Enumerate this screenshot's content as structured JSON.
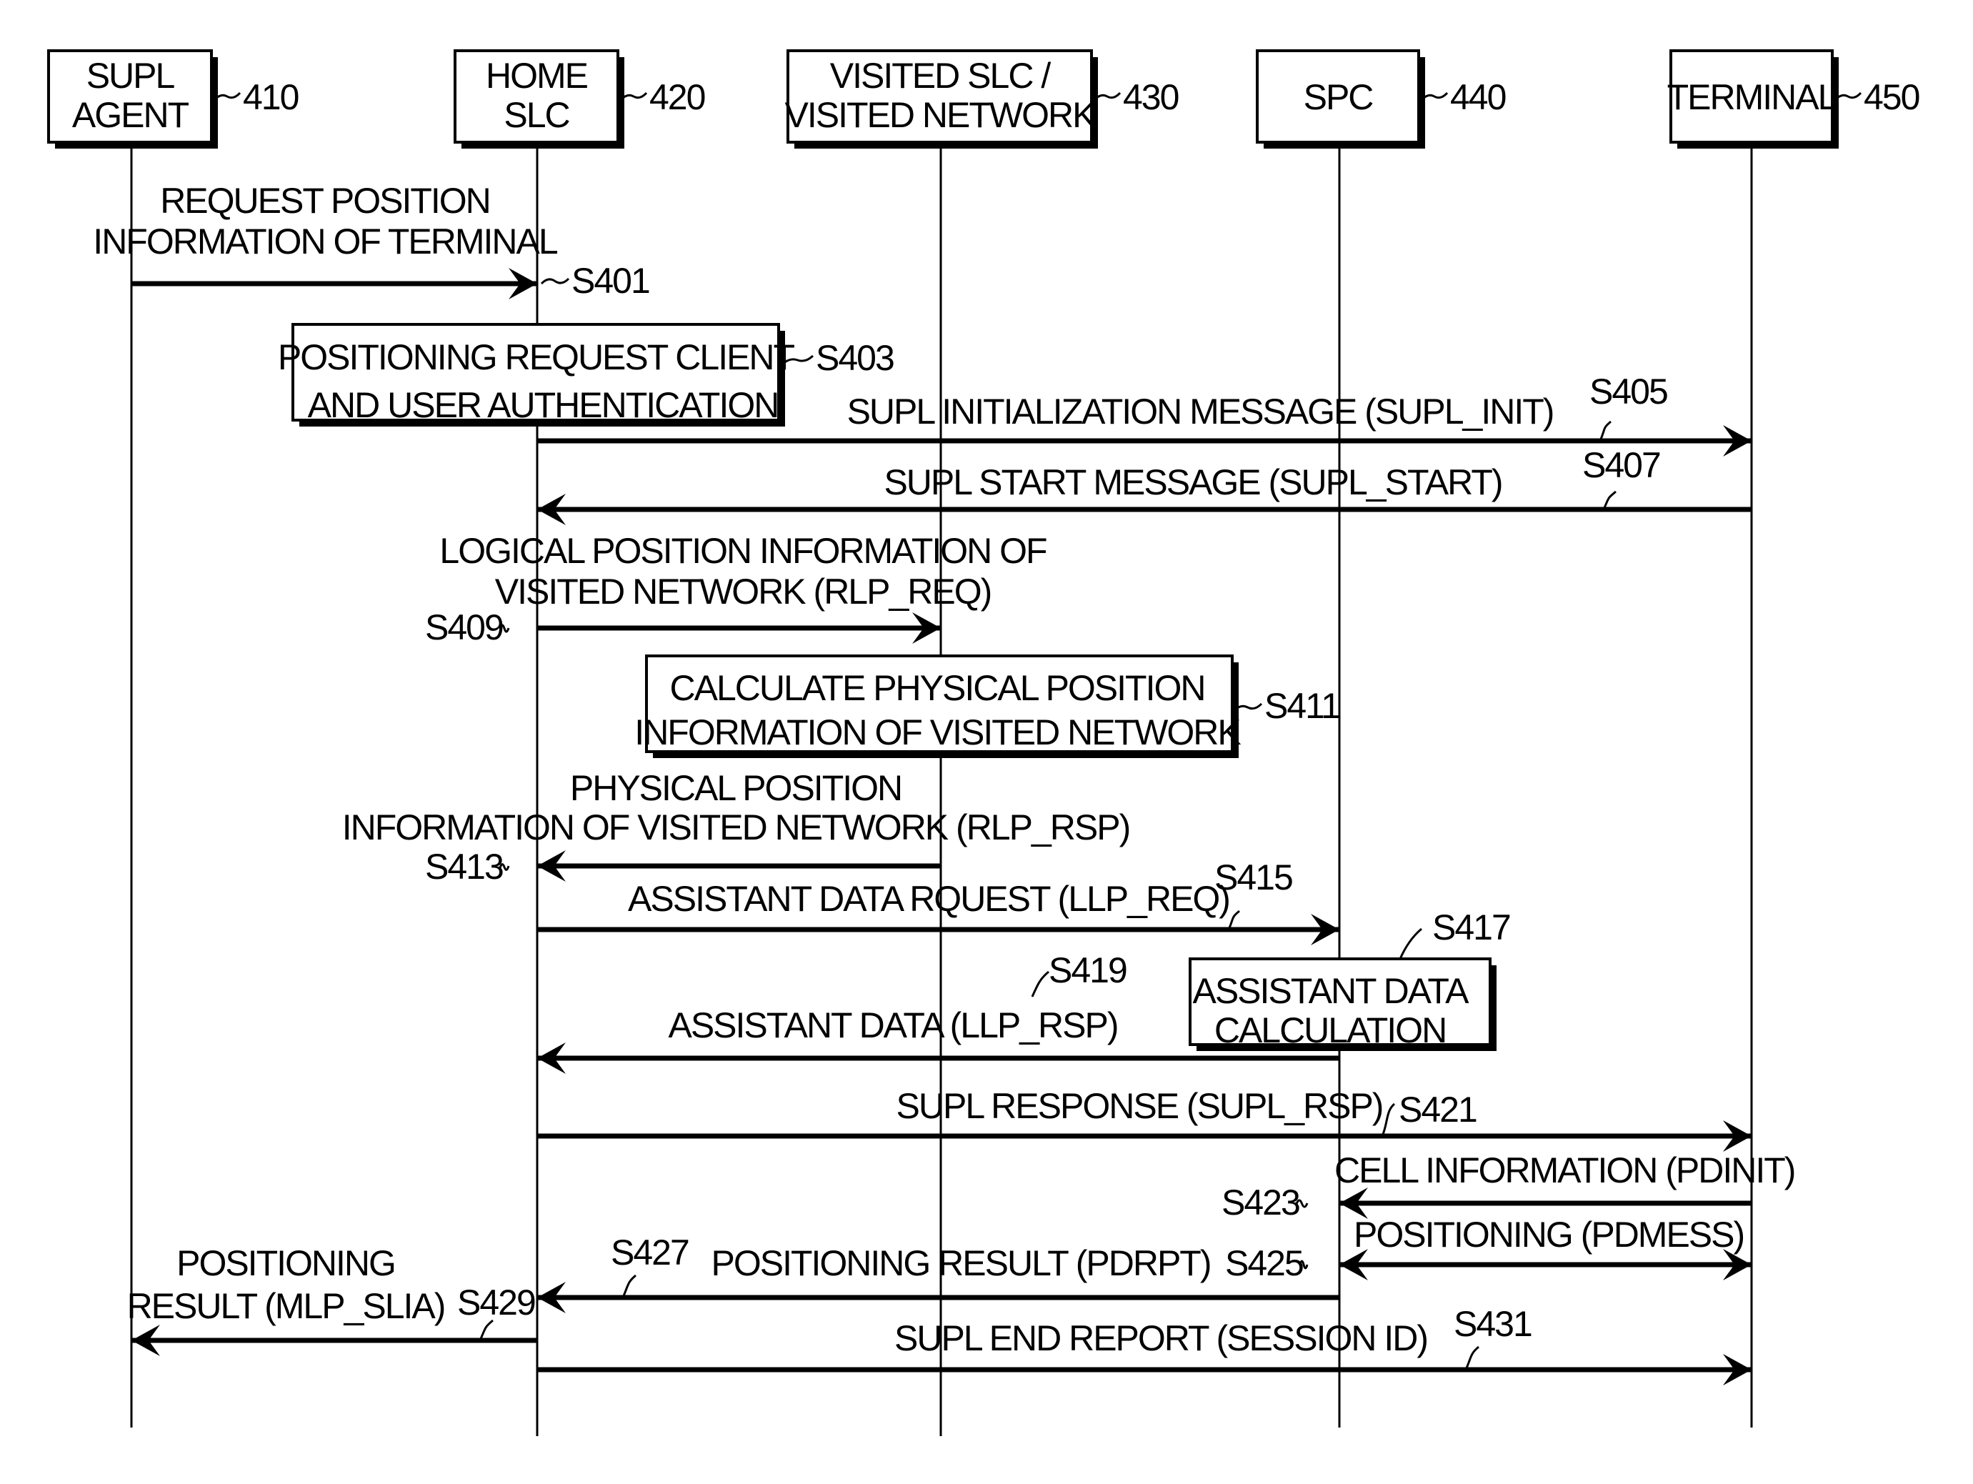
{
  "figure": {
    "participants": [
      {
        "id": "supl_agent",
        "lines": [
          "SUPL",
          "AGENT"
        ],
        "ref": "410"
      },
      {
        "id": "home_slc",
        "lines": [
          "HOME",
          "SLC"
        ],
        "ref": "420"
      },
      {
        "id": "visited_slc",
        "lines": [
          "VISITED SLC /",
          "VISITED NETWORK"
        ],
        "ref": "430"
      },
      {
        "id": "spc",
        "lines": [
          "SPC"
        ],
        "ref": "440"
      },
      {
        "id": "terminal",
        "lines": [
          "TERMINAL"
        ],
        "ref": "450"
      }
    ],
    "steps": [
      {
        "step": "S401",
        "kind": "message",
        "from": "supl_agent",
        "to": "home_slc",
        "lines": [
          "REQUEST POSITION",
          "INFORMATION OF TERMINAL"
        ]
      },
      {
        "step": "S403",
        "kind": "process",
        "at": "home_slc",
        "lines": [
          "POSITIONING REQUEST CLIENT",
          "AND USER AUTHENTICATION"
        ]
      },
      {
        "step": "S405",
        "kind": "message",
        "from": "home_slc",
        "to": "terminal",
        "lines": [
          "SUPL INITIALIZATION MESSAGE (SUPL_INIT)"
        ]
      },
      {
        "step": "S407",
        "kind": "message",
        "from": "terminal",
        "to": "home_slc",
        "lines": [
          "SUPL START MESSAGE (SUPL_START)"
        ]
      },
      {
        "step": "S409",
        "kind": "message",
        "from": "home_slc",
        "to": "visited_slc",
        "lines": [
          "LOGICAL POSITION INFORMATION OF",
          "VISITED NETWORK  (RLP_REQ)"
        ]
      },
      {
        "step": "S411",
        "kind": "process",
        "at": "visited_slc",
        "lines": [
          "CALCULATE PHYSICAL POSITION",
          "INFORMATION OF VISITED NETWORK"
        ]
      },
      {
        "step": "S413",
        "kind": "message",
        "from": "visited_slc",
        "to": "home_slc",
        "lines": [
          "PHYSICAL POSITION",
          "INFORMATION OF VISITED NETWORK (RLP_RSP)"
        ]
      },
      {
        "step": "S415",
        "kind": "message",
        "from": "home_slc",
        "to": "spc",
        "lines": [
          "ASSISTANT DATA RQUEST (LLP_REQ)"
        ]
      },
      {
        "step": "S417",
        "kind": "process",
        "at": "spc",
        "lines": [
          "ASSISTANT DATA",
          "CALCULATION"
        ]
      },
      {
        "step": "S419",
        "kind": "message",
        "from": "spc",
        "to": "home_slc",
        "lines": [
          "ASSISTANT DATA (LLP_RSP)"
        ]
      },
      {
        "step": "S421",
        "kind": "message",
        "from": "home_slc",
        "to": "terminal",
        "lines": [
          "SUPL RESPONSE (SUPL_RSP)"
        ]
      },
      {
        "step": "S423",
        "kind": "message",
        "from": "terminal",
        "to": "spc",
        "lines": [
          "CELL INFORMATION (PDINIT)"
        ]
      },
      {
        "step": "S425",
        "kind": "bidirectional",
        "from": "spc",
        "to": "terminal",
        "lines": [
          "POSITIONING (PDMESS)"
        ]
      },
      {
        "step": "S427",
        "kind": "message",
        "from": "spc",
        "to": "home_slc",
        "lines": [
          "POSITIONING RESULT (PDRPT)"
        ]
      },
      {
        "step": "S429",
        "kind": "message",
        "from": "home_slc",
        "to": "supl_agent",
        "lines": [
          "POSITIONING",
          "RESULT (MLP_SLIA)"
        ]
      },
      {
        "step": "S431",
        "kind": "message",
        "from": "home_slc",
        "to": "terminal",
        "lines": [
          "SUPL END REPORT (SESSION ID)"
        ]
      }
    ]
  }
}
